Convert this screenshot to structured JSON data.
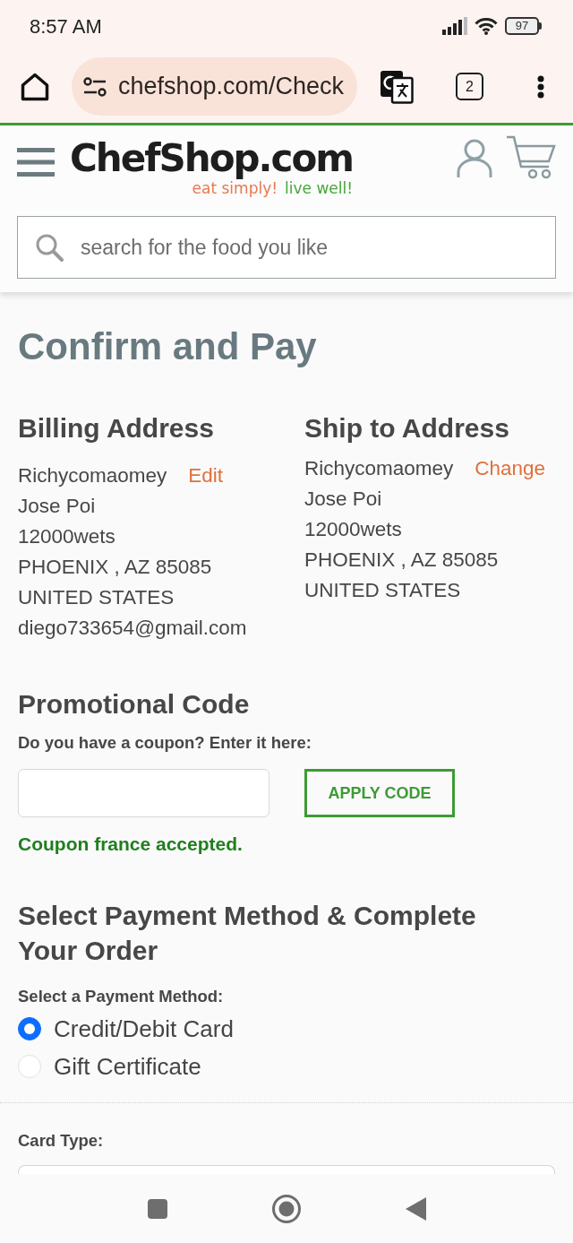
{
  "status_bar": {
    "time": "8:57 AM",
    "battery": "97"
  },
  "browser": {
    "url": "chefshop.com/Check",
    "tab_count": "2"
  },
  "site_header": {
    "logo": "ChefShop.com",
    "tagline_first": "eat simply!",
    "tagline_second": "live well!",
    "search": {
      "placeholder": "search for the food you like"
    }
  },
  "page": {
    "title": "Confirm and Pay"
  },
  "billing_address": {
    "heading": "Billing Address",
    "lines": [
      "Richycomaomey",
      "Jose Poi",
      "12000wets",
      "PHOENIX , AZ 85085",
      "UNITED STATES",
      "diego733654@gmail.com"
    ],
    "action": "Edit"
  },
  "ship_address": {
    "heading": "Ship to Address",
    "lines": [
      "Richycomaomey",
      "Jose Poi",
      "12000wets",
      "PHOENIX , AZ 85085",
      "UNITED STATES"
    ],
    "action": "Change"
  },
  "promo": {
    "heading": "Promotional Code",
    "label": "Do you have a coupon? Enter it here:",
    "button": "APPLY CODE",
    "message": "Coupon france accepted."
  },
  "payment": {
    "heading": "Select Payment Method & Complete Your Order",
    "label": "Select a Payment Method:",
    "options": [
      {
        "label": "Credit/Debit Card",
        "selected": true
      },
      {
        "label": "Gift Certificate",
        "selected": false
      }
    ]
  },
  "card_type": {
    "label": "Card Type:"
  }
}
